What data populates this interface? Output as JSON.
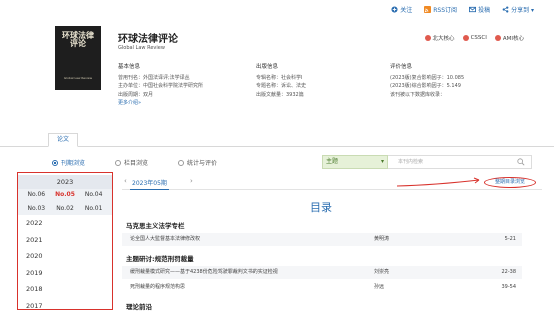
{
  "topbar": {
    "actions": [
      {
        "label": "关注",
        "icon": "plus-icon"
      },
      {
        "label": "RSS订阅",
        "icon": "rss-icon"
      },
      {
        "label": "投稿",
        "icon": "mail-icon"
      },
      {
        "label": "分享到 ▾",
        "icon": "share-icon"
      }
    ]
  },
  "journal": {
    "cover_title": "环球法律评论",
    "cover_en": "Global Law Review",
    "title": "环球法律评论",
    "subtitle": "Global Law Review"
  },
  "badges": [
    {
      "label": "北大核心"
    },
    {
      "label": "CSSCI"
    },
    {
      "label": "AMI核心"
    }
  ],
  "info": {
    "basic": {
      "heading": "基本信息",
      "lines": [
        "曾用刊名：外国法译评;法学译丛",
        "主办单位：中国社会科学院法学研究所",
        "出版周期：双月"
      ],
      "more": "更多介绍»"
    },
    "publish": {
      "heading": "出版信息",
      "lines": [
        "专辑名称：社会科学Ⅰ",
        "专题名称：诉讼、法史",
        "出版文献量：3932篇"
      ]
    },
    "eval": {
      "heading": "评价信息",
      "lines": [
        "(2023版)复合影响因子：10.085",
        "(2023版)综合影响因子：5.149",
        "该刊被以下数据库收录："
      ]
    }
  },
  "tabs": [
    "论文"
  ],
  "modes": [
    {
      "label": "刊期浏览",
      "active": true
    },
    {
      "label": "栏目浏览",
      "active": false
    },
    {
      "label": "统计与评价",
      "active": false
    }
  ],
  "search": {
    "select_value": "主题",
    "placeholder": "本刊内检索"
  },
  "years": {
    "current": "2023",
    "issues": [
      "No.06",
      "No.05",
      "No.04",
      "No.03",
      "No.02",
      "No.01"
    ],
    "selected_issue": "No.05",
    "list": [
      "2022",
      "2021",
      "2020",
      "2019",
      "2018",
      "2017"
    ]
  },
  "issue_tab": "2023年05期",
  "browse_button": "整期目录浏览",
  "toc_title": "目录",
  "sections": [
    {
      "title": "马克思主义法学专栏",
      "articles": [
        {
          "title": "论全国人大監督基本法律修改权",
          "author": "黄明涛",
          "pages": "5-21"
        }
      ]
    },
    {
      "title": "主题研讨:规范刑罚裁量",
      "articles": [
        {
          "title": "缓刑裁量模式研究——基于4238份危险驾驶罪裁判文书的实证检视",
          "author": "刘崇亮",
          "pages": "22-38"
        },
        {
          "title": "死刑裁量的程序规范构思",
          "author": "孙远",
          "pages": "39-54"
        }
      ]
    },
    {
      "title": "理论前沿",
      "articles": []
    }
  ],
  "colors": {
    "accent": "#2a6db0",
    "highlight": "#d8322c",
    "select_green": "#e6f1d8"
  }
}
